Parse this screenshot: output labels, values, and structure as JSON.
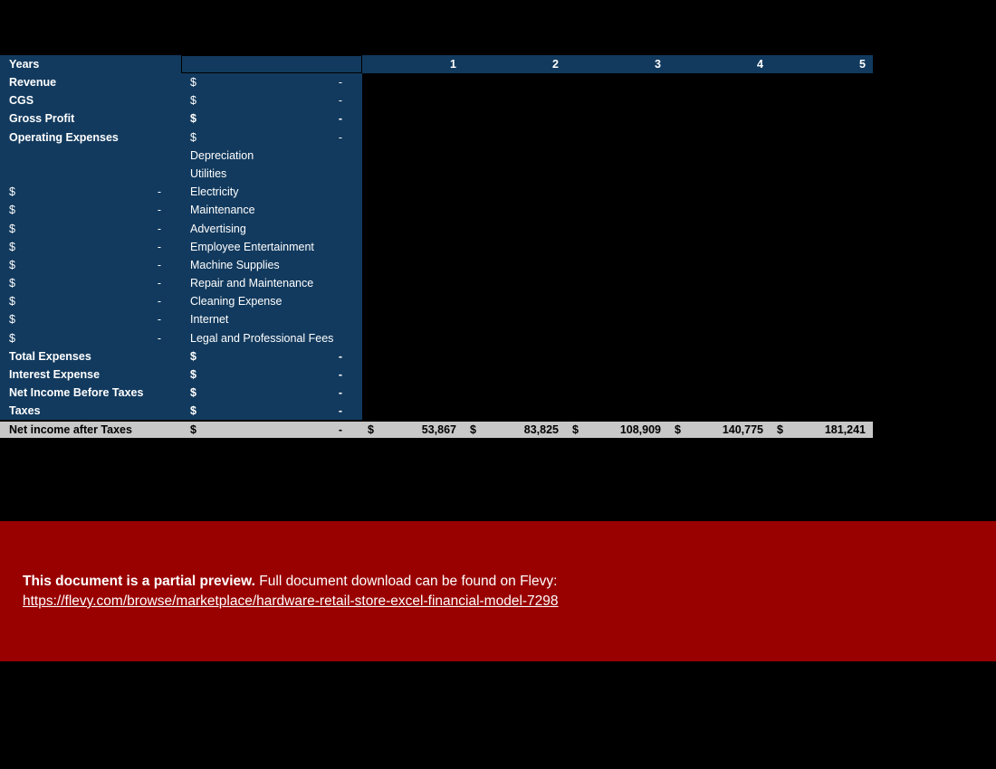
{
  "statement": {
    "header": {
      "label": "Years",
      "year_columns": [
        "1",
        "2",
        "3",
        "4",
        "5"
      ]
    },
    "rows": [
      {
        "label": "Revenue",
        "mid_symbol": "$",
        "mid_value": "-"
      },
      {
        "label": "CGS",
        "mid_symbol": "$",
        "mid_value": "-"
      },
      {
        "label": "Gross Profit",
        "mid_symbol": "$",
        "mid_value": "-"
      },
      {
        "label": "Operating Expenses",
        "mid_symbol": "$",
        "mid_value": "-"
      },
      {
        "item": "Depreciation"
      },
      {
        "item": "Utilities"
      },
      {
        "left_symbol": "$",
        "left_value": "-",
        "item": "Electricity"
      },
      {
        "left_symbol": "$",
        "left_value": "-",
        "item": "Maintenance"
      },
      {
        "left_symbol": "$",
        "left_value": "-",
        "item": "Advertising"
      },
      {
        "left_symbol": "$",
        "left_value": "-",
        "item": "Employee Entertainment"
      },
      {
        "left_symbol": "$",
        "left_value": "-",
        "item": "Machine Supplies"
      },
      {
        "left_symbol": "$",
        "left_value": "-",
        "item": "Repair and Maintenance"
      },
      {
        "left_symbol": "$",
        "left_value": "-",
        "item": "Cleaning Expense"
      },
      {
        "left_symbol": "$",
        "left_value": "-",
        "item": "Internet"
      },
      {
        "left_symbol": "$",
        "left_value": "-",
        "item": "Legal and Professional Fees"
      },
      {
        "label": "Total Expenses",
        "mid_symbol": "$",
        "mid_value": "-"
      },
      {
        "label": "Interest Expense",
        "mid_symbol": "$",
        "mid_value": "-"
      },
      {
        "label": "Net Income Before Taxes",
        "mid_symbol": "$",
        "mid_value": "-"
      },
      {
        "label": "Taxes",
        "mid_symbol": "$",
        "mid_value": "-"
      }
    ],
    "total_row": {
      "label": "Net income after Taxes",
      "mid_symbol": "$",
      "mid_value": "-",
      "currency_symbol": "$",
      "year_values": [
        "53,867",
        "83,825",
        "108,909",
        "140,775",
        "181,241"
      ]
    }
  },
  "banner": {
    "strong_text": "This document is a partial preview.",
    "rest_text": "Full document download can be found on Flevy:",
    "url": "https://flevy.com/browse/marketplace/hardware-retail-store-excel-financial-model-7298"
  },
  "colors": {
    "panel_navy": "#123A5E",
    "total_grey": "#C8C8C8",
    "banner_red": "#990000",
    "page_black": "#000000"
  }
}
